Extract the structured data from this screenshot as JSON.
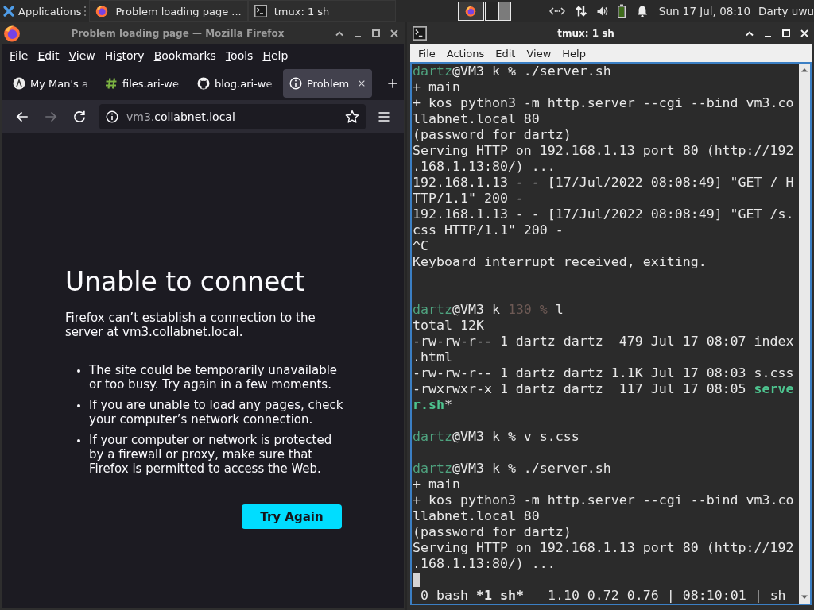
{
  "panel": {
    "menu_label": "Applications",
    "tasks": [
      {
        "kind": "browser",
        "label": "Problem loading page ..."
      },
      {
        "kind": "terminal",
        "label": "tmux: 1 sh"
      }
    ],
    "clock": "Sun 17 Jul, 08:10",
    "user": "Darty uwu"
  },
  "browser": {
    "title": "Problem loading page — Mozilla Firefox",
    "active": false,
    "menu": [
      {
        "key": "F",
        "rest": "ile"
      },
      {
        "key": "E",
        "rest": "dit"
      },
      {
        "key": "V",
        "rest": "iew"
      },
      {
        "pre": "Hi",
        "key": "s",
        "rest": "tory"
      },
      {
        "key": "B",
        "rest": "ookmarks"
      },
      {
        "key": "T",
        "rest": "ools"
      },
      {
        "key": "H",
        "rest": "elp"
      }
    ],
    "tabs": [
      {
        "kind": "site",
        "label": "My Man's a",
        "selected": false
      },
      {
        "kind": "site",
        "label": "files.ari-we",
        "selected": false
      },
      {
        "kind": "site",
        "label": "blog.ari-we",
        "selected": false
      },
      {
        "kind": "error",
        "label": "Problem",
        "selected": true
      }
    ],
    "nav_buttons": [
      {
        "kind": "back",
        "disabled": false
      },
      {
        "kind": "forward",
        "disabled": true
      },
      {
        "kind": "reload",
        "disabled": false
      }
    ],
    "url": {
      "subdomain": "vm3.",
      "domain": "collabnet.local"
    },
    "error_page": {
      "heading": "Unable to connect",
      "message": "Firefox can’t establish a connection to the server at vm3.collabnet.local.",
      "suggestions": [
        "The site could be temporarily unavailable or too busy. Try again in a few moments.",
        "If you are unable to load any pages, check your computer’s network connection.",
        "If your computer or network is protected by a firewall or proxy, make sure that Firefox is permitted to access the Web."
      ],
      "button": "Try Again"
    }
  },
  "terminal": {
    "title": "tmux: 1 sh",
    "active": true,
    "menu": [
      "File",
      "Actions",
      "Edit",
      "View",
      "Help"
    ],
    "lines": [
      {
        "kind": "text",
        "segments": [
          {
            "text": "dartz",
            "kind": "user"
          },
          {
            "text": "@VM3 k % ./server.sh",
            "kind": "plain"
          }
        ]
      },
      {
        "kind": "text",
        "segments": [
          {
            "text": "+ main",
            "kind": "plain"
          }
        ]
      },
      {
        "kind": "text",
        "segments": [
          {
            "text": "+ kos python3 -m http.server --cgi --bind vm3.co",
            "kind": "plain"
          }
        ]
      },
      {
        "kind": "text",
        "segments": [
          {
            "text": "llabnet.local 80",
            "kind": "plain"
          }
        ]
      },
      {
        "kind": "text",
        "segments": [
          {
            "text": "(password for dartz)",
            "kind": "plain"
          }
        ]
      },
      {
        "kind": "text",
        "segments": [
          {
            "text": "Serving HTTP on 192.168.1.13 port 80 (http://192",
            "kind": "plain"
          }
        ]
      },
      {
        "kind": "text",
        "segments": [
          {
            "text": ".168.1.13:80/) ...",
            "kind": "plain"
          }
        ]
      },
      {
        "kind": "text",
        "segments": [
          {
            "text": "192.168.1.13 - - [17/Jul/2022 08:08:49] \"GET / H",
            "kind": "plain"
          }
        ]
      },
      {
        "kind": "text",
        "segments": [
          {
            "text": "TTP/1.1\" 200 -",
            "kind": "plain"
          }
        ]
      },
      {
        "kind": "text",
        "segments": [
          {
            "text": "192.168.1.13 - - [17/Jul/2022 08:08:49] \"GET /s.",
            "kind": "plain"
          }
        ]
      },
      {
        "kind": "text",
        "segments": [
          {
            "text": "css HTTP/1.1\" 200 -",
            "kind": "plain"
          }
        ]
      },
      {
        "kind": "text",
        "segments": [
          {
            "text": "^C",
            "kind": "plain"
          }
        ]
      },
      {
        "kind": "text",
        "segments": [
          {
            "text": "Keyboard interrupt received, exiting.",
            "kind": "plain"
          }
        ]
      },
      {
        "kind": "blank"
      },
      {
        "kind": "blank"
      },
      {
        "kind": "text",
        "segments": [
          {
            "text": "dartz",
            "kind": "user"
          },
          {
            "text": "@VM3 k ",
            "kind": "plain"
          },
          {
            "text": "130 %",
            "kind": "faint"
          },
          {
            "text": " l",
            "kind": "plain"
          }
        ]
      },
      {
        "kind": "text",
        "segments": [
          {
            "text": "total 12K",
            "kind": "plain"
          }
        ]
      },
      {
        "kind": "text",
        "segments": [
          {
            "text": "-rw-rw-r-- 1 dartz dartz  479 Jul 17 08:07 index",
            "kind": "plain"
          }
        ]
      },
      {
        "kind": "text",
        "segments": [
          {
            "text": ".html",
            "kind": "plain"
          }
        ]
      },
      {
        "kind": "text",
        "segments": [
          {
            "text": "-rw-rw-r-- 1 dartz dartz 1.1K Jul 17 08:03 s.css",
            "kind": "plain"
          }
        ]
      },
      {
        "kind": "text",
        "segments": [
          {
            "text": "-rwxrwxr-x 1 dartz dartz  117 Jul 17 08:05 ",
            "kind": "plain"
          },
          {
            "text": "serve",
            "kind": "executable"
          }
        ]
      },
      {
        "kind": "text",
        "segments": [
          {
            "text": "r.sh",
            "kind": "executable"
          },
          {
            "text": "*",
            "kind": "plain"
          }
        ]
      },
      {
        "kind": "blank"
      },
      {
        "kind": "text",
        "segments": [
          {
            "text": "dartz",
            "kind": "user"
          },
          {
            "text": "@VM3 k % v s.css",
            "kind": "plain"
          }
        ]
      },
      {
        "kind": "blank"
      },
      {
        "kind": "text",
        "segments": [
          {
            "text": "dartz",
            "kind": "user"
          },
          {
            "text": "@VM3 k % ./server.sh",
            "kind": "plain"
          }
        ]
      },
      {
        "kind": "text",
        "segments": [
          {
            "text": "+ main",
            "kind": "plain"
          }
        ]
      },
      {
        "kind": "text",
        "segments": [
          {
            "text": "+ kos python3 -m http.server --cgi --bind vm3.co",
            "kind": "plain"
          }
        ]
      },
      {
        "kind": "text",
        "segments": [
          {
            "text": "llabnet.local 80",
            "kind": "plain"
          }
        ]
      },
      {
        "kind": "text",
        "segments": [
          {
            "text": "(password for dartz)",
            "kind": "plain"
          }
        ]
      },
      {
        "kind": "text",
        "segments": [
          {
            "text": "Serving HTTP on 192.168.1.13 port 80 (http://192",
            "kind": "plain"
          }
        ]
      },
      {
        "kind": "text",
        "segments": [
          {
            "text": ".168.1.13:80/) ...",
            "kind": "plain"
          }
        ]
      },
      {
        "kind": "cursor"
      }
    ],
    "status": {
      "windows": [
        {
          "label": "0 bash",
          "selected": false
        },
        {
          "label": "*1 sh*",
          "selected": true
        }
      ],
      "right": "1.10 0.72 0.76 | 08:10:01 | sh"
    }
  }
}
